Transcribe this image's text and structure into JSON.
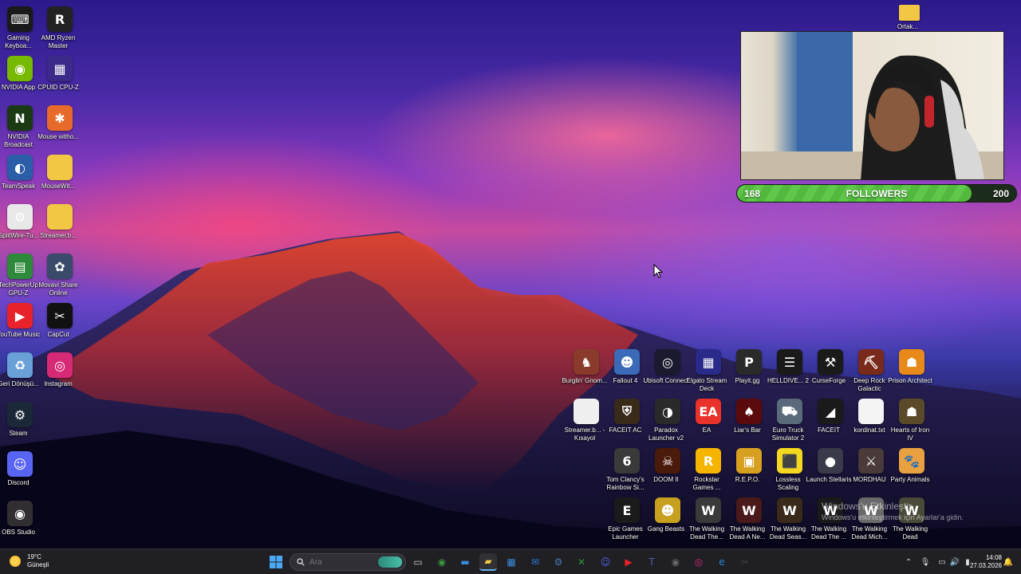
{
  "desktop": {
    "left_icons": [
      {
        "label": "Gaming Keyboa...",
        "icon": "keyboard-icon",
        "color": "#1a1a1a",
        "glyph": "⌨"
      },
      {
        "label": "AMD Ryzen Master",
        "icon": "ryzen-icon",
        "color": "#222222",
        "glyph": "R"
      },
      {
        "label": "NVIDIA App",
        "icon": "nvidia-icon",
        "color": "#76b900",
        "glyph": "◉"
      },
      {
        "label": "CPUID CPU-Z",
        "icon": "cpuz-icon",
        "color": "#3b2a8a",
        "glyph": "▦"
      },
      {
        "label": "NVIDIA Broadcast",
        "icon": "nvidia-broadcast-icon",
        "color": "#1b3a14",
        "glyph": "N"
      },
      {
        "label": "Mouse witho...",
        "icon": "mouse-without-borders-icon",
        "color": "#e86a2a",
        "glyph": "✱"
      },
      {
        "label": "TeamSpeak",
        "icon": "teamspeak-icon",
        "color": "#2b5da8",
        "glyph": "◐"
      },
      {
        "label": "MouseWit...",
        "icon": "folder-icon",
        "color": "#f2c744",
        "glyph": ""
      },
      {
        "label": "SplitWire-Tu...",
        "icon": "splitwire-icon",
        "color": "#e8e8e8",
        "glyph": "⚙"
      },
      {
        "label": "Streamer.b...",
        "icon": "folder-icon",
        "color": "#f2c744",
        "glyph": ""
      },
      {
        "label": "TechPowerUp GPU-Z",
        "icon": "gpuz-icon",
        "color": "#2e8a3a",
        "glyph": "▤"
      },
      {
        "label": "Movavi Share Online",
        "icon": "movavi-icon",
        "color": "#3a4a6a",
        "glyph": "✿"
      },
      {
        "label": "YouTube Music",
        "icon": "youtube-music-icon",
        "color": "#e8222a",
        "glyph": "▶"
      },
      {
        "label": "CapCut",
        "icon": "capcut-icon",
        "color": "#111111",
        "glyph": "✂"
      },
      {
        "label": "Geri Dönüşü...",
        "icon": "recycle-bin-icon",
        "color": "#6aa0d8",
        "glyph": "♻"
      },
      {
        "label": "Instagram",
        "icon": "instagram-icon",
        "color": "#d62976",
        "glyph": "◎"
      },
      {
        "label": "Steam",
        "icon": "steam-icon",
        "color": "#1b2838",
        "glyph": "⚙"
      },
      {
        "label": "Discord",
        "icon": "discord-icon",
        "color": "#5865f2",
        "glyph": "☺"
      },
      {
        "label": "OBS Studio",
        "icon": "obs-icon",
        "color": "#302e31",
        "glyph": "◉"
      }
    ],
    "right_icons": [
      {
        "label": "Burglin' Gnom...",
        "icon": "burglin-gnomes-icon",
        "color": "#8a3a2a",
        "glyph": "♞"
      },
      {
        "label": "Fallout 4",
        "icon": "fallout4-icon",
        "color": "#3a6ab8",
        "glyph": "☻"
      },
      {
        "label": "Ubisoft Connect",
        "icon": "ubisoft-icon",
        "color": "#1a1a2e",
        "glyph": "◎"
      },
      {
        "label": "Elgato Stream Deck",
        "icon": "stream-deck-icon",
        "color": "#2a2a8a",
        "glyph": "▦"
      },
      {
        "label": "Playit.gg",
        "icon": "playit-icon",
        "color": "#2a2a2a",
        "glyph": "P"
      },
      {
        "label": "HELLDIVE... 2",
        "icon": "helldivers-icon",
        "color": "#1a1a1a",
        "glyph": "☰"
      },
      {
        "label": "CurseForge",
        "icon": "curseforge-icon",
        "color": "#1a1a1a",
        "glyph": "⚒"
      },
      {
        "label": "Deep Rock Galactic",
        "icon": "deep-rock-icon",
        "color": "#7a2a1a",
        "glyph": "⛏"
      },
      {
        "label": "Prison Architect",
        "icon": "prison-architect-icon",
        "color": "#e88a1a",
        "glyph": "☗"
      },
      {
        "label": "Streamer.b... - Kısayol",
        "icon": "file-icon",
        "color": "#f0f0f0",
        "glyph": ""
      },
      {
        "label": "FACEIT AC",
        "icon": "faceit-ac-icon",
        "color": "#3a2a1a",
        "glyph": "⛨"
      },
      {
        "label": "Paradox Launcher v2",
        "icon": "paradox-icon",
        "color": "#2a2a2a",
        "glyph": "◑"
      },
      {
        "label": "EA",
        "icon": "ea-icon",
        "color": "#e8322a",
        "glyph": "EA"
      },
      {
        "label": "Liar's Bar",
        "icon": "liars-bar-icon",
        "color": "#5a0a0a",
        "glyph": "♠"
      },
      {
        "label": "Euro Truck Simulator 2",
        "icon": "euro-truck-icon",
        "color": "#5a6a7a",
        "glyph": "⛟"
      },
      {
        "label": "FACEIT",
        "icon": "faceit-icon",
        "color": "#1a1a1a",
        "glyph": "◢"
      },
      {
        "label": "kordinat.txt",
        "icon": "text-file-icon",
        "color": "#f4f4f4",
        "glyph": ""
      },
      {
        "label": "Hearts of Iron IV",
        "icon": "hoi4-icon",
        "color": "#5a4a2a",
        "glyph": "☗"
      },
      {
        "label": "Tom Clancy's Rainbow Si...",
        "icon": "rainbow-six-icon",
        "color": "#3a3a3a",
        "glyph": "6"
      },
      {
        "label": "DOOM II",
        "icon": "doom2-icon",
        "color": "#4a1a0a",
        "glyph": "☠"
      },
      {
        "label": "Rockstar Games ...",
        "icon": "rockstar-icon",
        "color": "#f4b400",
        "glyph": "R"
      },
      {
        "label": "R.E.P.O.",
        "icon": "repo-icon",
        "color": "#d8a020",
        "glyph": "▣"
      },
      {
        "label": "Lossless Scaling",
        "icon": "lossless-scaling-icon",
        "color": "#f4d820",
        "glyph": "⬛"
      },
      {
        "label": "Launch Stellaris",
        "icon": "stellaris-icon",
        "color": "#3a3a4a",
        "glyph": "●"
      },
      {
        "label": "MORDHAU",
        "icon": "mordhau-icon",
        "color": "#4a3a3a",
        "glyph": "⚔"
      },
      {
        "label": "Party Animals",
        "icon": "party-animals-icon",
        "color": "#e8a040",
        "glyph": "🐾"
      },
      {
        "label": "Epic Games Launcher",
        "icon": "epic-games-icon",
        "color": "#1a1a1a",
        "glyph": "E"
      },
      {
        "label": "Gang Beasts",
        "icon": "gang-beasts-icon",
        "color": "#c8a020",
        "glyph": "☻"
      },
      {
        "label": "The Walking Dead The...",
        "icon": "walking-dead-icon",
        "color": "#3a3a3a",
        "glyph": "W"
      },
      {
        "label": "The Walking Dead A Ne...",
        "icon": "walking-dead-icon",
        "color": "#4a1a1a",
        "glyph": "W"
      },
      {
        "label": "The Walking Dead Seas...",
        "icon": "walking-dead-icon",
        "color": "#3a2a1a",
        "glyph": "W"
      },
      {
        "label": "The Walking Dead The ...",
        "icon": "walking-dead-icon",
        "color": "#1a1a1a",
        "glyph": "W"
      },
      {
        "label": "The Walking Dead Mich...",
        "icon": "walking-dead-icon",
        "color": "#6a6a6a",
        "glyph": "W"
      },
      {
        "label": "The Walking Dead",
        "icon": "walking-dead-icon",
        "color": "#4a4a3a",
        "glyph": "W"
      }
    ],
    "top_right_folder": {
      "label": "Ortak...",
      "icon": "folder-icon",
      "color": "#f2c744"
    }
  },
  "overlay": {
    "followers_current": "168",
    "followers_label": "FOLLOWERS",
    "followers_goal": "200",
    "followers_progress": 0.84
  },
  "watermark": {
    "line1": "Windows'u Etkinleştir",
    "line2": "Windows'u etkinleştirmek için Ayarlar'a gidin."
  },
  "taskbar": {
    "weather_temp": "19°C",
    "weather_desc": "Güneşli",
    "search_placeholder": "Ara",
    "apps": [
      {
        "name": "start-button",
        "glyph": "⊞",
        "color": "#4aa0f0"
      },
      {
        "name": "task-view-icon",
        "glyph": "▭",
        "color": "#cccccc"
      },
      {
        "name": "chrome-icon",
        "glyph": "◉",
        "color": "#3a9a3a"
      },
      {
        "name": "desktop-app-icon",
        "glyph": "▬",
        "color": "#3a8ad8"
      },
      {
        "name": "file-explorer-icon",
        "glyph": "▰",
        "color": "#f2c744"
      },
      {
        "name": "store-icon",
        "glyph": "▦",
        "color": "#3a8ad8"
      },
      {
        "name": "outlook-icon",
        "glyph": "✉",
        "color": "#2a7ad8"
      },
      {
        "name": "steam-icon",
        "glyph": "⚙",
        "color": "#4a7ab8"
      },
      {
        "name": "xbox-icon",
        "glyph": "✕",
        "color": "#2a9a3a"
      },
      {
        "name": "discord-icon",
        "glyph": "☺",
        "color": "#5865f2"
      },
      {
        "name": "youtube-music-icon",
        "glyph": "▶",
        "color": "#e8222a"
      },
      {
        "name": "teams-icon",
        "glyph": "T",
        "color": "#5a5ab8"
      },
      {
        "name": "obs-icon",
        "glyph": "◉",
        "color": "#6a6a6a"
      },
      {
        "name": "instagram-icon",
        "glyph": "◎",
        "color": "#d62976"
      },
      {
        "name": "edge-icon",
        "glyph": "e",
        "color": "#2a8ad8"
      },
      {
        "name": "capcut-icon",
        "glyph": "✂",
        "color": "#444444"
      }
    ],
    "time": "14:08",
    "date": "27.03.2026"
  }
}
